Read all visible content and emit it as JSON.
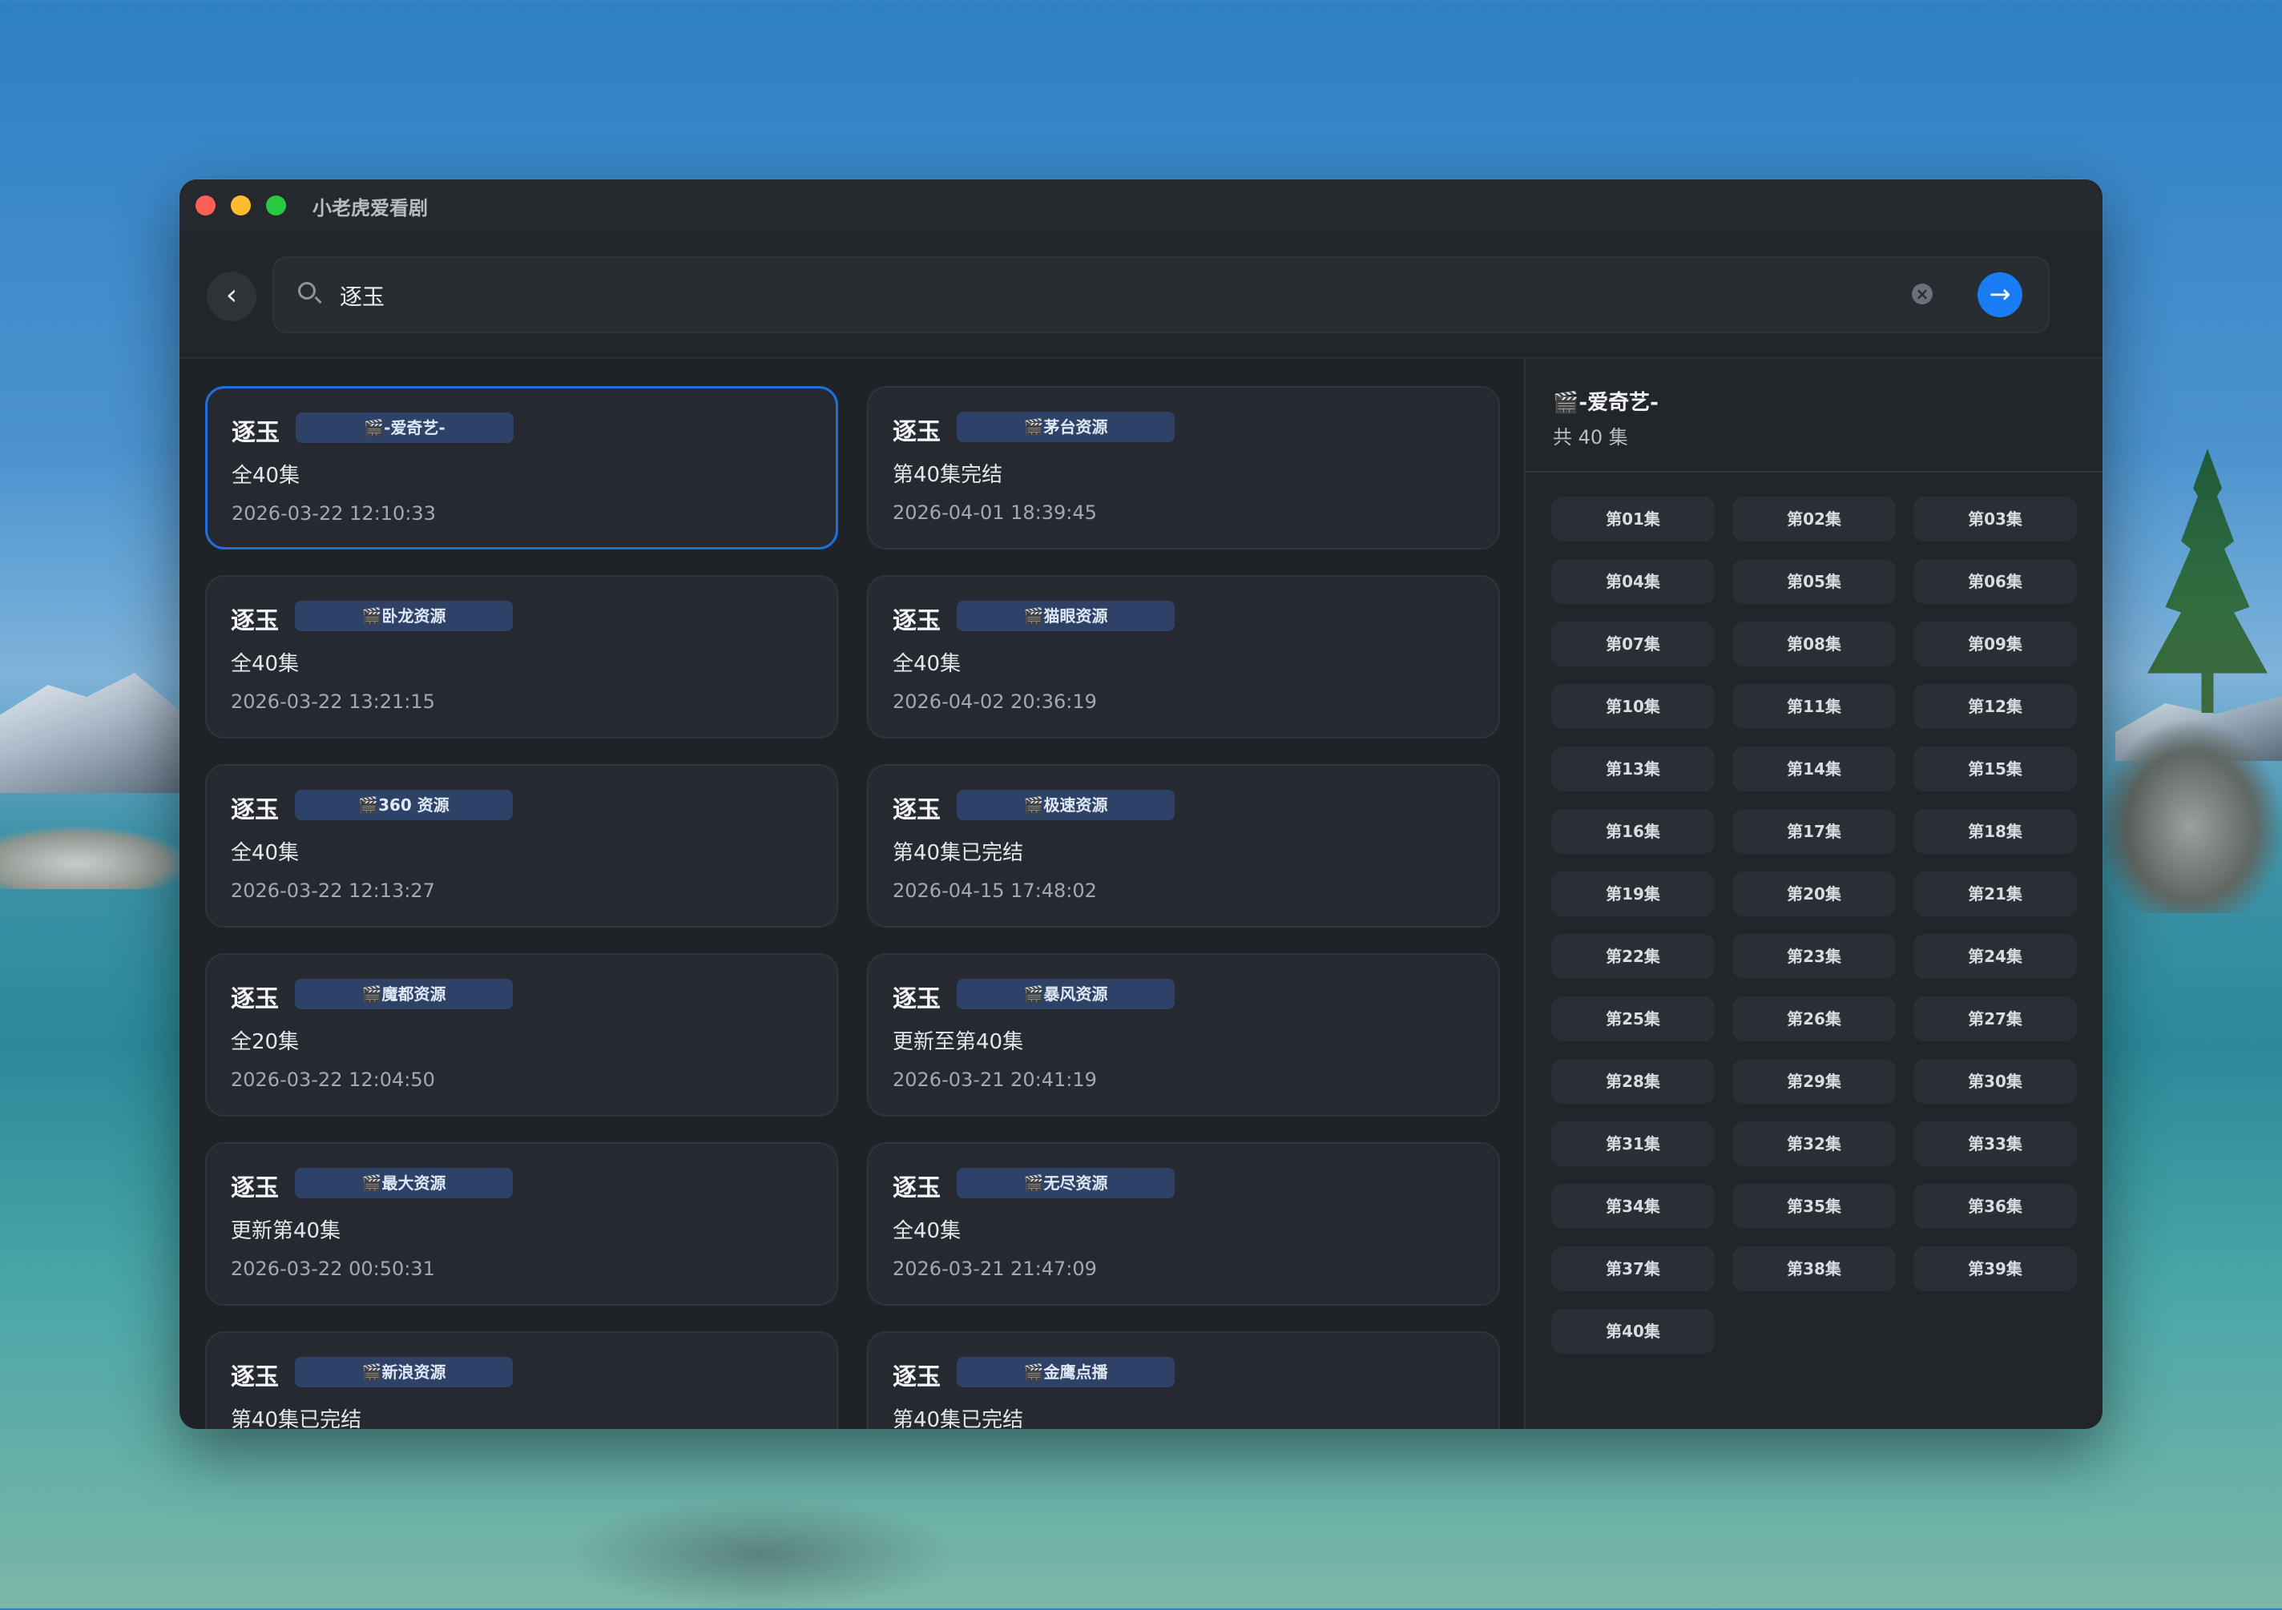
{
  "window": {
    "title": "小老虎爱看剧"
  },
  "search": {
    "query": "逐玉",
    "clear_label": "⊗",
    "back_label": "‹",
    "go_label": "→"
  },
  "results": [
    {
      "title": "逐玉",
      "source": "🎬-爱奇艺-",
      "status": "全40集",
      "date": "2026-03-22 12:10:33",
      "selected": true
    },
    {
      "title": "逐玉",
      "source": "🎬茅台资源",
      "status": "第40集完结",
      "date": "2026-04-01 18:39:45"
    },
    {
      "title": "逐玉",
      "source": "🎬卧龙资源",
      "status": "全40集",
      "date": "2026-03-22 13:21:15"
    },
    {
      "title": "逐玉",
      "source": "🎬猫眼资源",
      "status": "全40集",
      "date": "2026-04-02 20:36:19"
    },
    {
      "title": "逐玉",
      "source": "🎬360 资源",
      "status": "全40集",
      "date": "2026-03-22 12:13:27"
    },
    {
      "title": "逐玉",
      "source": "🎬极速资源",
      "status": "第40集已完结",
      "date": "2026-04-15 17:48:02"
    },
    {
      "title": "逐玉",
      "source": "🎬魔都资源",
      "status": "全20集",
      "date": "2026-03-22 12:04:50"
    },
    {
      "title": "逐玉",
      "source": "🎬暴风资源",
      "status": "更新至第40集",
      "date": "2026-03-21 20:41:19"
    },
    {
      "title": "逐玉",
      "source": "🎬最大资源",
      "status": "更新第40集",
      "date": "2026-03-22 00:50:31"
    },
    {
      "title": "逐玉",
      "source": "🎬无尽资源",
      "status": "全40集",
      "date": "2026-03-21 21:47:09"
    },
    {
      "title": "逐玉",
      "source": "🎬新浪资源",
      "status": "第40集已完结",
      "date": ""
    },
    {
      "title": "逐玉",
      "source": "🎬金鹰点播",
      "status": "第40集已完结",
      "date": ""
    }
  ],
  "detail": {
    "source": "🎬-爱奇艺-",
    "episode_count": "共 40 集",
    "episodes": [
      "第01集",
      "第02集",
      "第03集",
      "第04集",
      "第05集",
      "第06集",
      "第07集",
      "第08集",
      "第09集",
      "第10集",
      "第11集",
      "第12集",
      "第13集",
      "第14集",
      "第15集",
      "第16集",
      "第17集",
      "第18集",
      "第19集",
      "第20集",
      "第21集",
      "第22集",
      "第23集",
      "第24集",
      "第25集",
      "第26集",
      "第27集",
      "第28集",
      "第29集",
      "第30集",
      "第31集",
      "第32集",
      "第33集",
      "第34集",
      "第35集",
      "第36集",
      "第37集",
      "第38集",
      "第39集",
      "第40集"
    ]
  },
  "colors": {
    "accent": "#1a7cf2",
    "selected_border": "#1e6fe0",
    "badge_bg": "#2d4266"
  }
}
